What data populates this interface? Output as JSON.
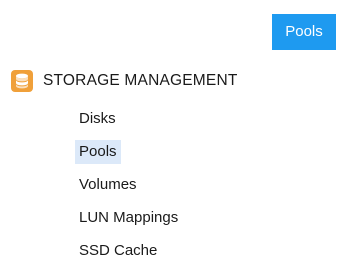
{
  "header": {
    "active_tab_label": "Pools"
  },
  "section": {
    "title": "STORAGE MANAGEMENT",
    "icon": "database-icon",
    "icon_color": "#f0a03a"
  },
  "nav": {
    "items": [
      {
        "label": "Disks",
        "selected": false
      },
      {
        "label": "Pools",
        "selected": true
      },
      {
        "label": "Volumes",
        "selected": false
      },
      {
        "label": "LUN Mappings",
        "selected": false
      },
      {
        "label": "SSD Cache",
        "selected": false
      }
    ],
    "selected_bg": "#dce9f9"
  },
  "colors": {
    "accent": "#1e9af0"
  }
}
